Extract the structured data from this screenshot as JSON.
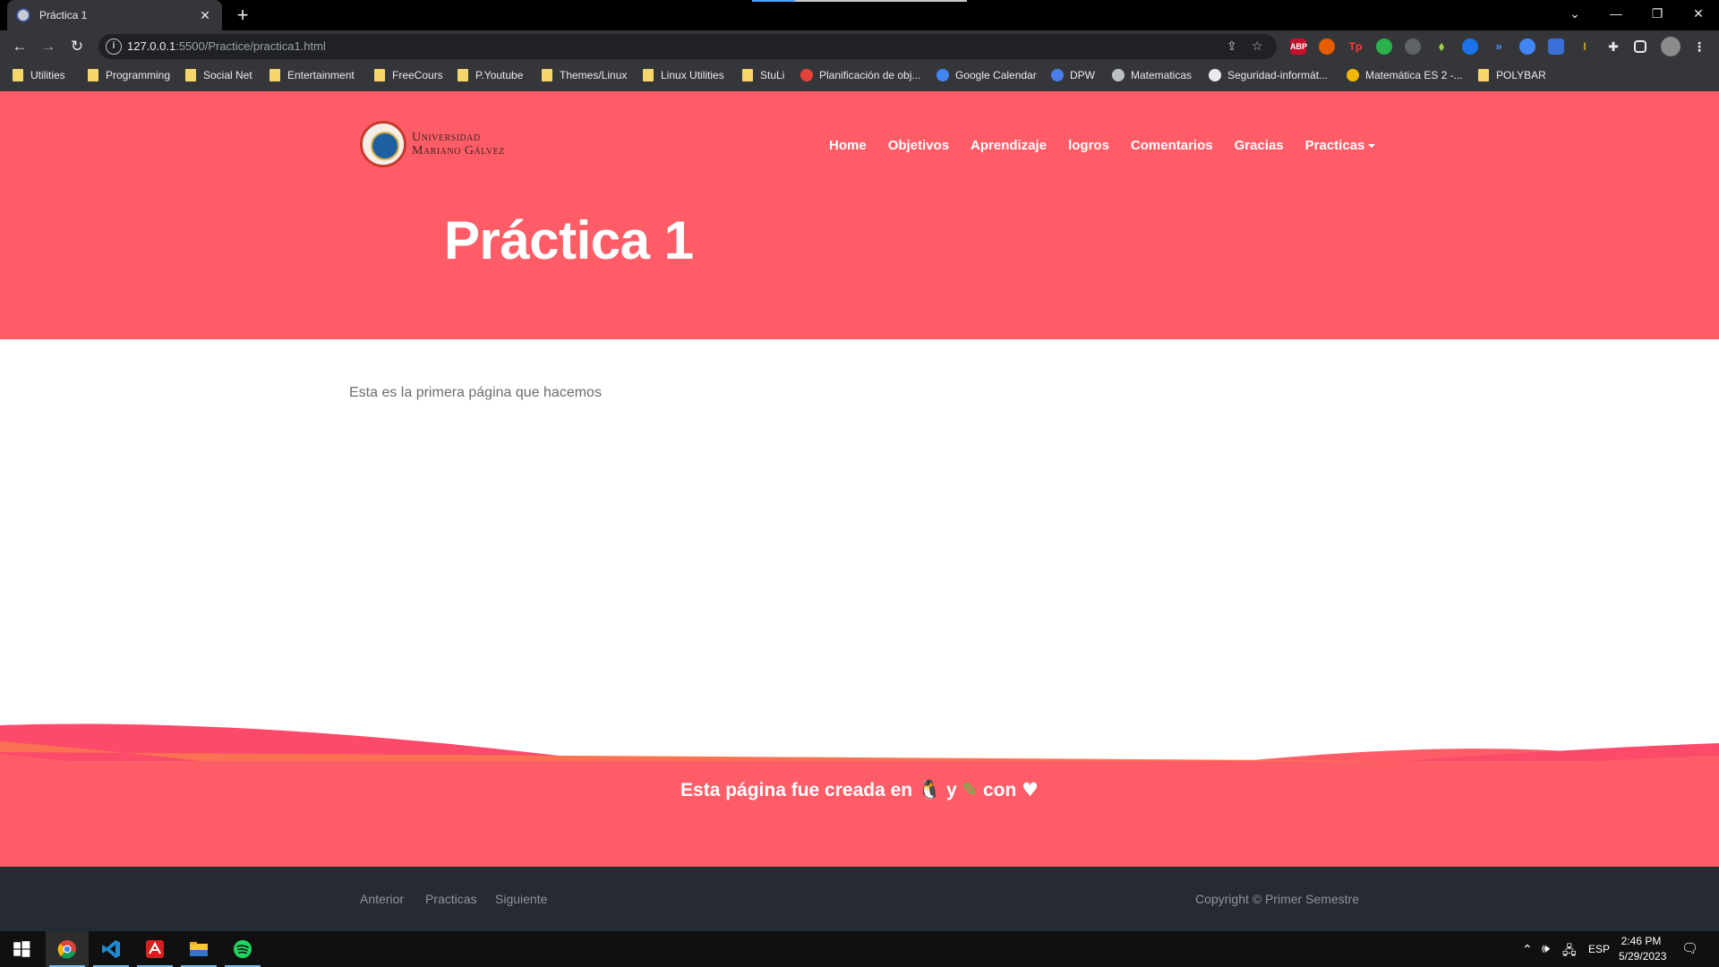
{
  "browser": {
    "tab_title": "Práctica 1",
    "tab_close": "✕",
    "new_tab": "+",
    "url_host": "127.0.0.1",
    "url_path": ":5500/Practice/practica1.html",
    "window_controls": {
      "chevron": "⌄",
      "minimize": "—",
      "restore": "❐",
      "close": "✕"
    },
    "nav": {
      "back": "←",
      "forward": "→",
      "reload": "↻"
    }
  },
  "bookmarks": [
    {
      "label": "Utilities",
      "type": "folder"
    },
    {
      "label": "Programming",
      "type": "folder"
    },
    {
      "label": "Social Net",
      "type": "folder"
    },
    {
      "label": "Entertainment",
      "type": "folder"
    },
    {
      "label": "FreeCours",
      "type": "folder"
    },
    {
      "label": "P.Youtube",
      "type": "folder"
    },
    {
      "label": "Themes/Linux",
      "type": "folder"
    },
    {
      "label": "Linux Utilities",
      "type": "folder"
    },
    {
      "label": "StuLi",
      "type": "folder"
    },
    {
      "label": "Planificación de obj...",
      "type": "site",
      "color": "#e8403b"
    },
    {
      "label": "Google Calendar",
      "type": "site",
      "color": "#4285f4"
    },
    {
      "label": "DPW",
      "type": "site",
      "color": "#4a7de8"
    },
    {
      "label": "Matematicas",
      "type": "site",
      "color": "#bdc1c6"
    },
    {
      "label": "Seguridad-informát...",
      "type": "site",
      "color": "#e8eaed"
    },
    {
      "label": "Matemática ES 2 -...",
      "type": "site",
      "color": "#f2b705"
    },
    {
      "label": "POLYBAR",
      "type": "folder"
    }
  ],
  "site": {
    "logo_line1": "Universidad",
    "logo_line2": "Mariano Gálvez",
    "menu": [
      "Home",
      "Objetivos",
      "Aprendizaje",
      "logros",
      "Comentarios",
      "Gracias",
      "Practicas"
    ],
    "hero_title": "Práctica 1",
    "lead": "Esta es la primera página que hacemos",
    "made_with_prefix": "Esta página fue creada en",
    "made_with_icon1": "🐧",
    "made_with_mid": "y",
    "made_with_icon2": "✎",
    "made_with_suffix": "con",
    "made_with_heart": "♥",
    "footer_links": [
      "Anterior",
      "Practicas",
      "Siguiente"
    ],
    "copyright": "Copyright © Primer Semestre"
  },
  "taskbar": {
    "lang": "ESP",
    "time": "2:46 PM",
    "date": "5/29/2023",
    "apps": [
      "chrome-icon",
      "vscode-icon",
      "acrobat-icon",
      "file-explorer-icon",
      "spotify-icon"
    ]
  },
  "colors": {
    "hero": "#fe5d67",
    "wave_dark": "#fb4a6a",
    "wave_orange": "#fb7252",
    "footer_dark": "#252a33"
  }
}
